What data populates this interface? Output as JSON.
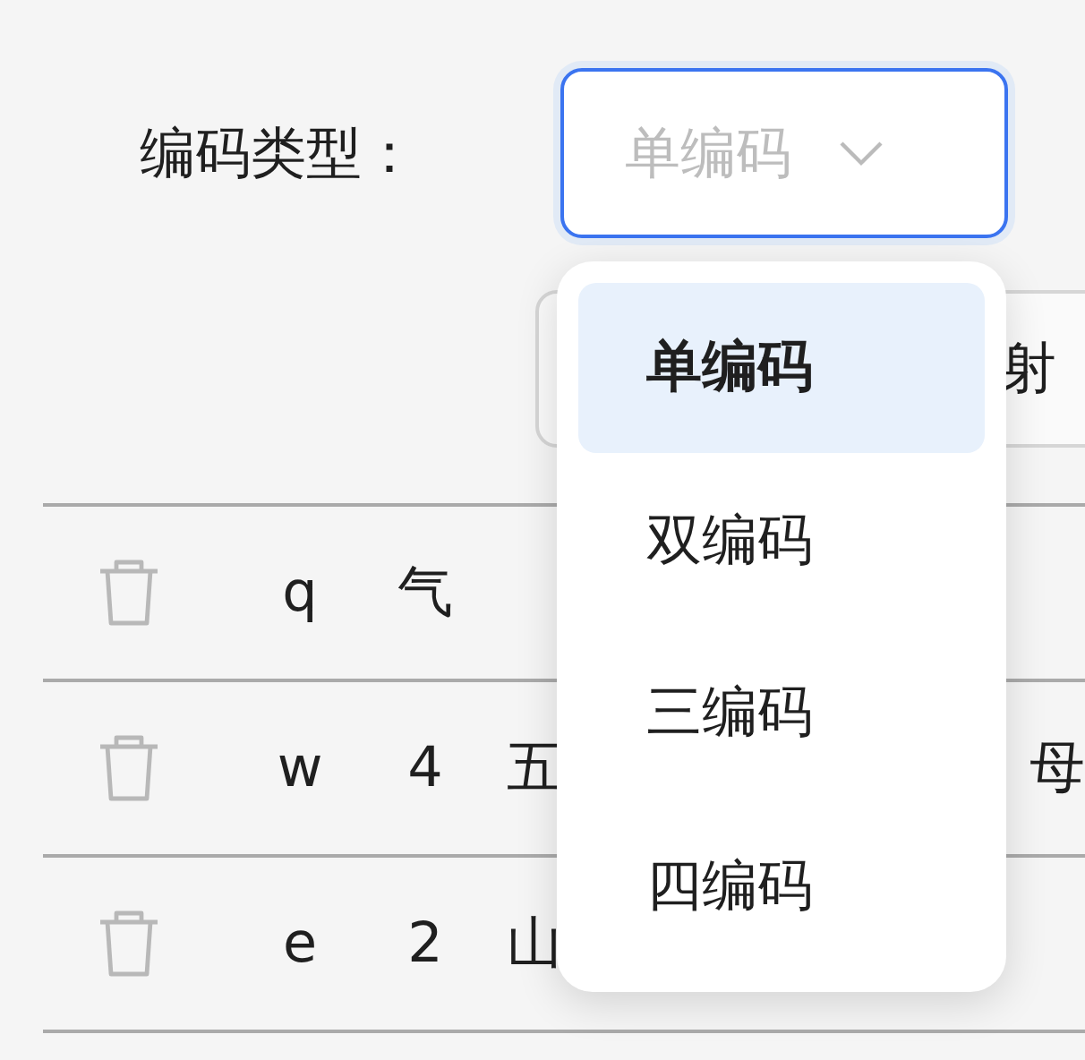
{
  "filter": {
    "label": "编码类型：",
    "select": {
      "placeholder": "单编码",
      "focused": true
    }
  },
  "dropdown": {
    "options": [
      {
        "label": "单编码",
        "selected": true
      },
      {
        "label": "双编码",
        "selected": false
      },
      {
        "label": "三编码",
        "selected": false
      },
      {
        "label": "四编码",
        "selected": false
      }
    ]
  },
  "toolbar": {
    "button": "射"
  },
  "table": {
    "rows": [
      {
        "column_2": "q",
        "column_3": "气"
      },
      {
        "column_2": "w",
        "column_3": "4",
        "column_4": "五",
        "column_5": "母"
      },
      {
        "column_2": "e",
        "column_3": "2",
        "column_4": "山"
      }
    ]
  }
}
